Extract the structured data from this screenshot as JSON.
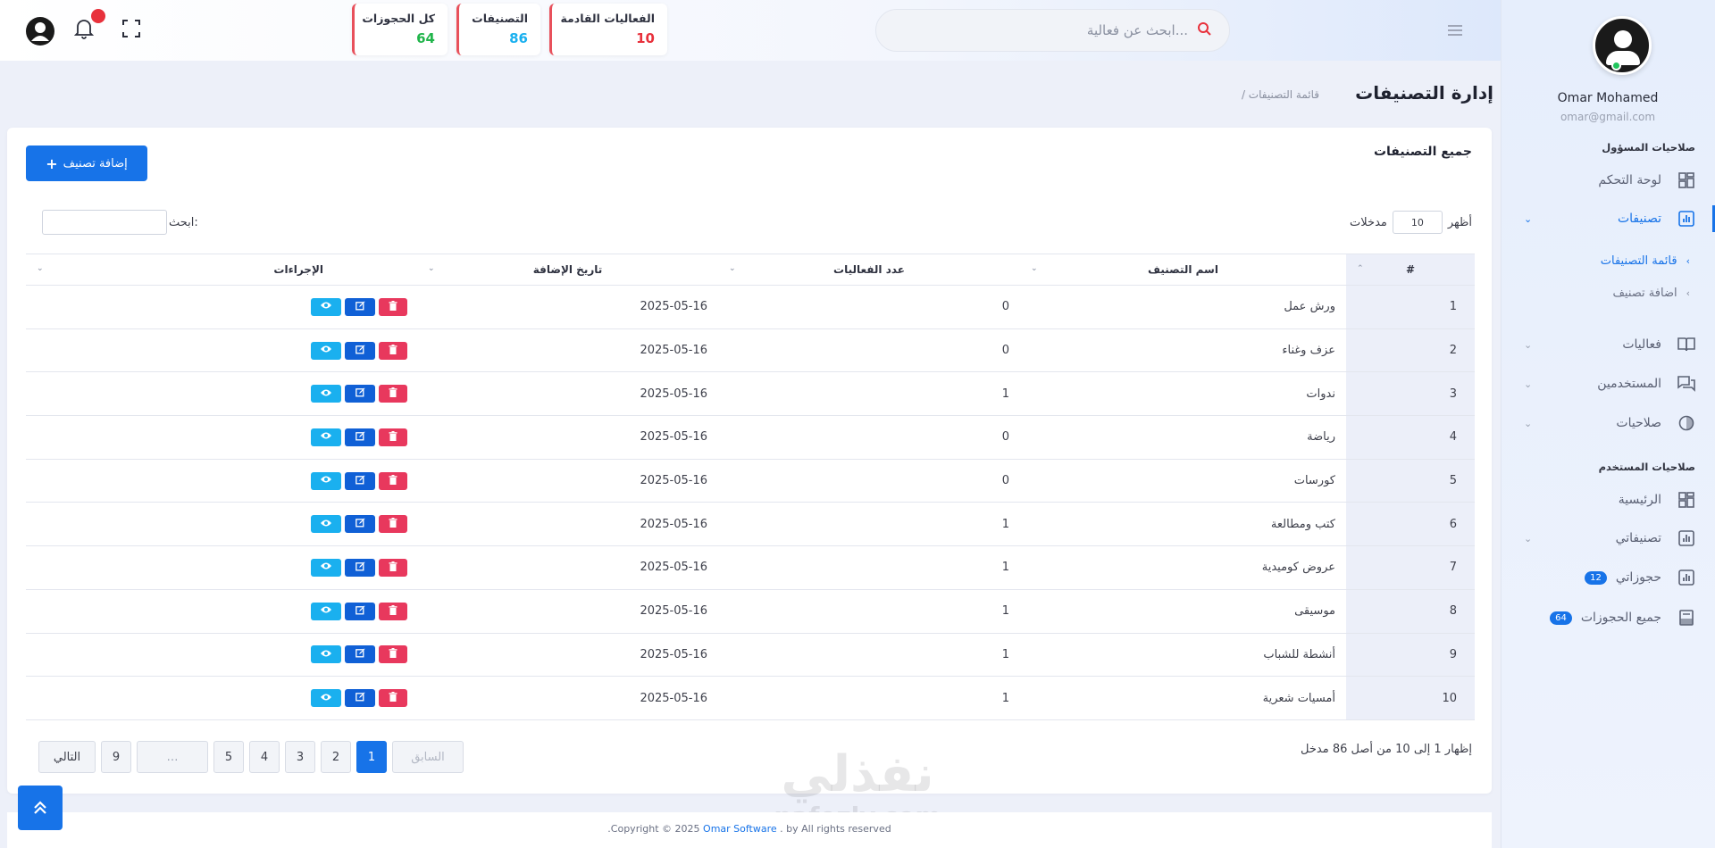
{
  "topbar": {
    "search_placeholder": "ابحث عن فعالية...",
    "stats": [
      {
        "title": "الفعاليات القادمة",
        "value": "10",
        "color": "#e8313c"
      },
      {
        "title": "التصنيفات",
        "value": "86",
        "color": "#1ab0ef"
      },
      {
        "title": "كل الحجوزات",
        "value": "64",
        "color": "#21b54b"
      }
    ]
  },
  "sidebar": {
    "user_name": "Omar Mohamed",
    "user_email": "omar@gmail.com",
    "section_admin": "صلاحيات المسؤول",
    "section_user": "صلاحيات المستخدم",
    "items": {
      "dashboard": "لوحة التحكم",
      "categories": "تصنيفات",
      "categories_list": "قائمة التصنيفات",
      "add_category": "اضافة تصنيف",
      "events": "فعاليات",
      "users": "المستخدمين",
      "permissions": "صلاحيات",
      "home": "الرئيسية",
      "my_categories": "تصنيفاتي",
      "my_bookings": "حجوزاتي",
      "my_bookings_count": "12",
      "all_bookings": "جميع الحجوزات",
      "all_bookings_count": "64"
    }
  },
  "header": {
    "title": "إدارة التصنيفات",
    "breadcrumb": "/ قائمة التصنيفات"
  },
  "card": {
    "title": "جميع التصنيفات",
    "add_button": "إضافة تصنيف",
    "show_label": "أظهر",
    "entries_label": "مدخلات",
    "entries_value": "10",
    "search_label": "ابحث:"
  },
  "table": {
    "headers": [
      "#",
      "اسم التصنيف",
      "عدد الفعاليات",
      "تاريخ الإضافة",
      "الإجراءات"
    ],
    "rows": [
      {
        "num": "1",
        "name": "ورش عمل",
        "count": "0",
        "date": "2025-05-16"
      },
      {
        "num": "2",
        "name": "عزف وغناء",
        "count": "0",
        "date": "2025-05-16"
      },
      {
        "num": "3",
        "name": "ندوات",
        "count": "1",
        "date": "2025-05-16"
      },
      {
        "num": "4",
        "name": "رياضة",
        "count": "0",
        "date": "2025-05-16"
      },
      {
        "num": "5",
        "name": "كورسات",
        "count": "0",
        "date": "2025-05-16"
      },
      {
        "num": "6",
        "name": "كتب ومطالعة",
        "count": "1",
        "date": "2025-05-16"
      },
      {
        "num": "7",
        "name": "عروض كوميدية",
        "count": "1",
        "date": "2025-05-16"
      },
      {
        "num": "8",
        "name": "موسيقى",
        "count": "1",
        "date": "2025-05-16"
      },
      {
        "num": "9",
        "name": "أنشطة للشباب",
        "count": "1",
        "date": "2025-05-16"
      },
      {
        "num": "10",
        "name": "أمسيات شعرية",
        "count": "1",
        "date": "2025-05-16"
      }
    ]
  },
  "pagination": {
    "info": "إظهار 1 إلى 10 من أصل 86 مدخل",
    "prev": "السابق",
    "next": "التالي",
    "pages": [
      "1",
      "2",
      "3",
      "4",
      "5",
      "…",
      "9"
    ]
  },
  "footer": {
    "text": ".Copyright © 2025 ",
    "brand": "Omar Software",
    "by": ". by",
    "rights": "All rights reserved"
  },
  "watermark": {
    "ar": "نفذلي",
    "en": "nafezly.com"
  },
  "colors": {
    "primary": "#1773e8",
    "view": "#1ab0ef",
    "edit": "#1060d6",
    "delete": "#e8385d"
  }
}
